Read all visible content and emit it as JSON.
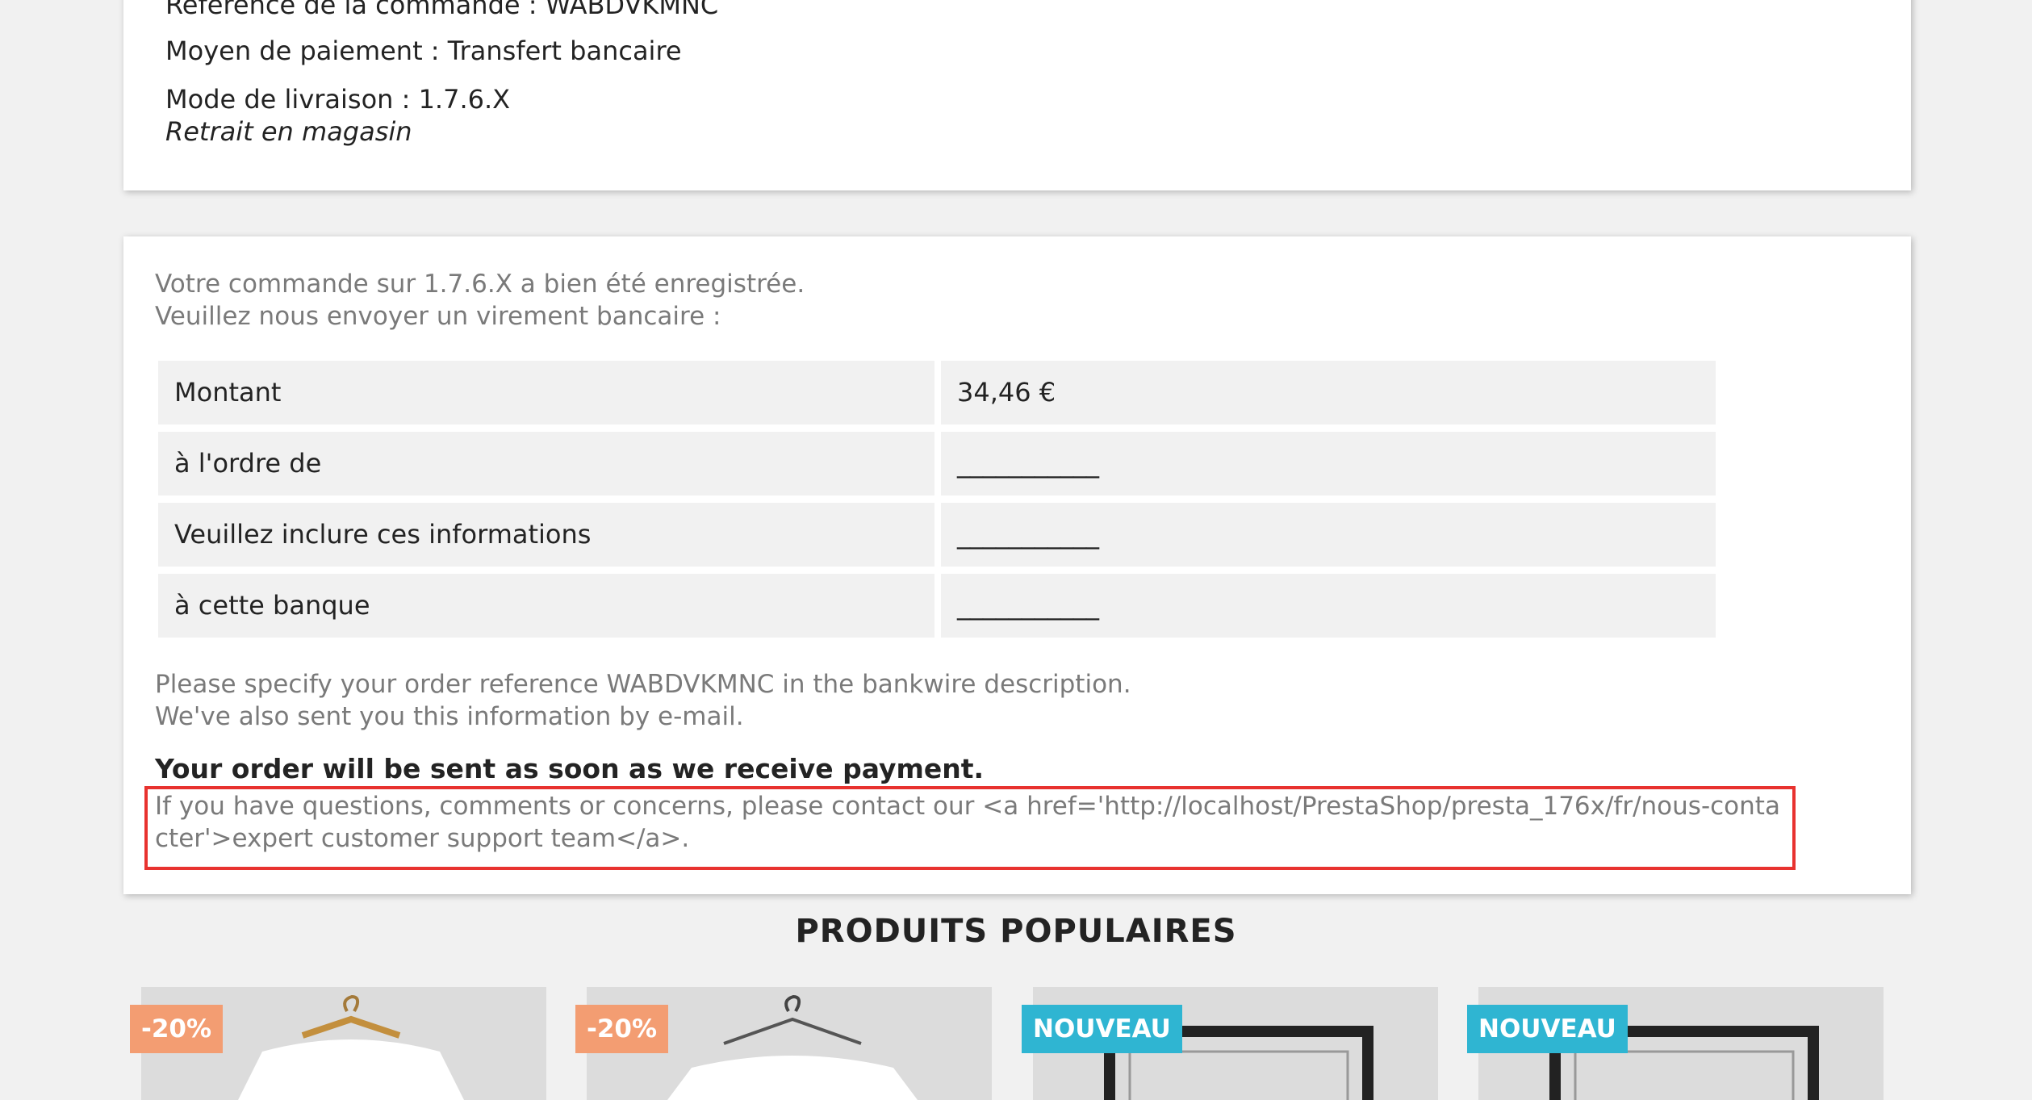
{
  "order_details": {
    "reference_line": "Référence de la commande : WABDVKMNC",
    "payment_line": "Moyen de paiement : Transfert bancaire",
    "delivery_line": "Mode de livraison : 1.7.6.X",
    "delivery_sub": "Retrait en magasin"
  },
  "bankwire": {
    "intro_1": "Votre commande sur 1.7.6.X a bien été enregistrée.",
    "intro_2": "Veuillez nous envoyer un virement bancaire :",
    "rows": [
      {
        "label": "Montant",
        "value": "34,46 €"
      },
      {
        "label": "à l'ordre de",
        "value": "___________"
      },
      {
        "label": "Veuillez inclure ces informations",
        "value": "___________"
      },
      {
        "label": "à cette banque",
        "value": "___________"
      }
    ],
    "note_1": "Please specify your order reference WABDVKMNC in the bankwire description.",
    "note_2": "We've also sent you this information by e-mail.",
    "bold_notice": "Your order will be sent as soon as we receive payment.",
    "contact_text": "If you have questions, comments or concerns, please contact our <a href='http://localhost/PrestaShop/presta_176x/fr/nous-contacter'>expert customer support team</a>."
  },
  "popular": {
    "title": "PRODUITS POPULAIRES",
    "badges": [
      "-20%",
      "-20%",
      "NOUVEAU",
      "NOUVEAU"
    ]
  },
  "colors": {
    "highlight": "#e8322f",
    "discount_badge": "#f39d72",
    "new_badge": "#2fb5d2"
  }
}
